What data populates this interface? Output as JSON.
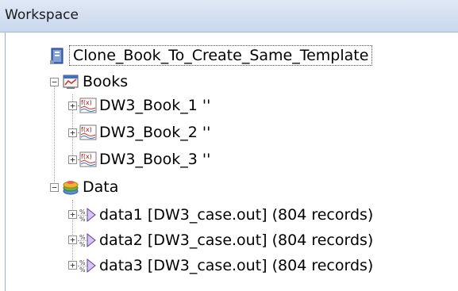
{
  "panel": {
    "title": "Workspace"
  },
  "tree": {
    "root": {
      "label": "Clone_Book_To_Create_Same_Template",
      "icon": "project-icon"
    },
    "books_folder": {
      "label": "Books",
      "icon": "books-folder-icon",
      "expanded": true
    },
    "books": [
      {
        "label": "DW3_Book_1 ''",
        "icon": "book-function-icon",
        "expanded": false
      },
      {
        "label": "DW3_Book_2 ''",
        "icon": "book-function-icon",
        "expanded": false
      },
      {
        "label": "DW3_Book_3 ''",
        "icon": "book-function-icon",
        "expanded": false
      }
    ],
    "data_folder": {
      "label": "Data",
      "icon": "data-folder-icon",
      "expanded": true
    },
    "data": [
      {
        "label": "data1 [DW3_case.out] (804 records)",
        "icon": "data-record-icon",
        "expanded": false
      },
      {
        "label": "data2 [DW3_case.out] (804 records)",
        "icon": "data-record-icon",
        "expanded": false
      },
      {
        "label": "data3 [DW3_case.out] (804 records)",
        "icon": "data-record-icon",
        "expanded": false
      }
    ],
    "expander_symbols": {
      "collapsed": "+",
      "expanded": "−"
    }
  }
}
